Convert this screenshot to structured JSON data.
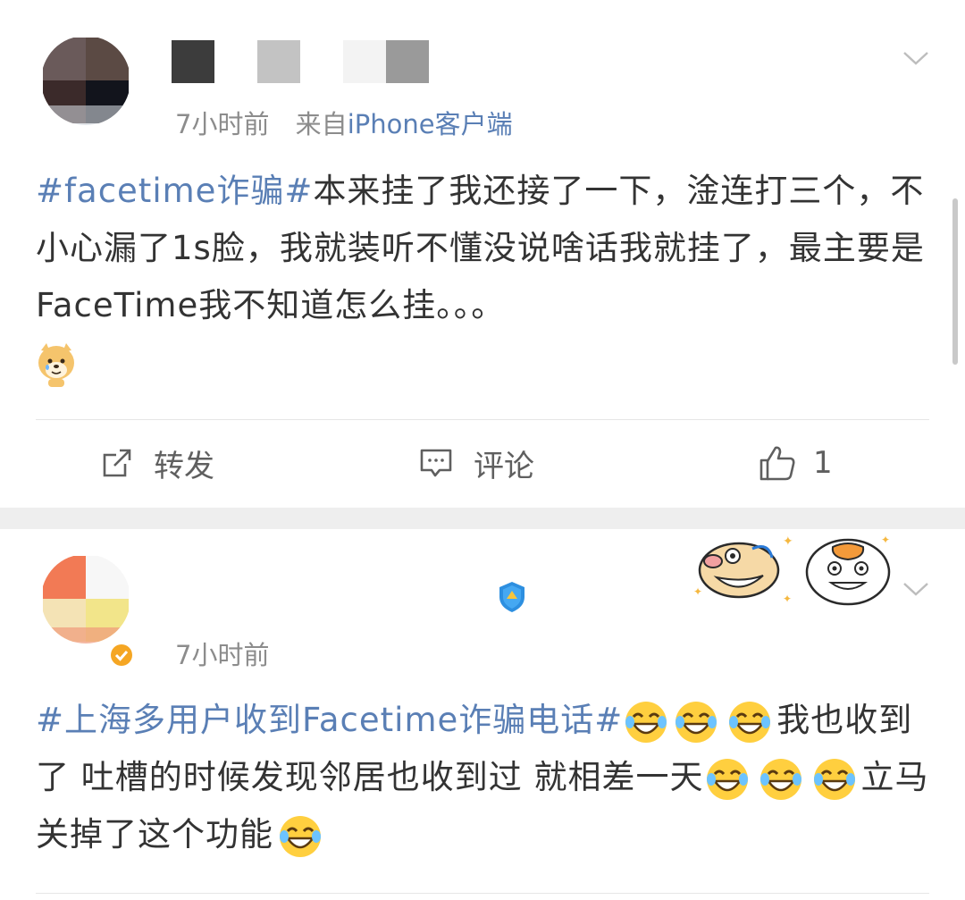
{
  "post1": {
    "time": "7小时前",
    "from_label": "来自",
    "source": "iPhone客户端",
    "hashtag": "#facetime诈骗#",
    "text": "本来挂了我还接了一下，淦连打三个，不小心漏了1s脸，我就装听不懂没说啥话我就挂了，最主要是FaceTime我不知道怎么挂。。。",
    "actions": {
      "repost": "转发",
      "comment": "评论",
      "like_count": "1"
    }
  },
  "post2": {
    "time": "7小时前",
    "hashtag": "#上海多用户收到Facetime诈骗电话#",
    "text_part1": "我也收到了 吐槽的时候发现邻居也收到过 就相差一天",
    "text_part2": "立马关掉了这个功能"
  },
  "colors": {
    "link": "#5a7fb5",
    "text": "#333333",
    "meta": "#8c8c8c",
    "separator": "#eeeeee"
  }
}
